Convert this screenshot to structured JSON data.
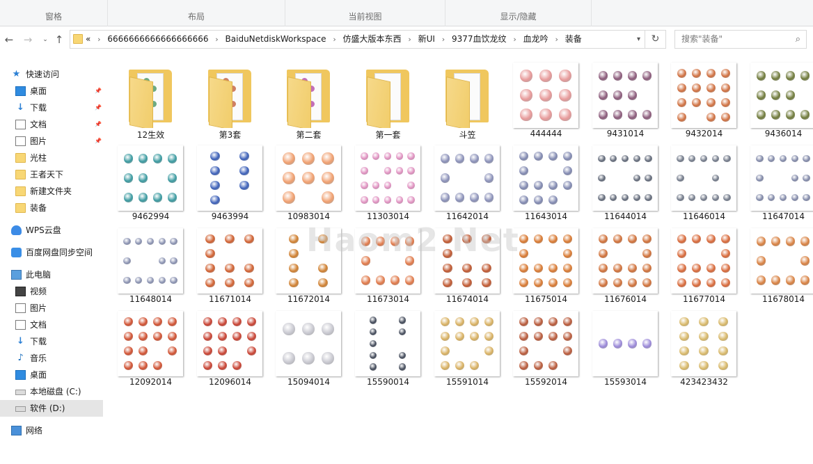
{
  "ribbon": {
    "groups": [
      "窗格",
      "布局",
      "当前视图",
      "显示/隐藏"
    ]
  },
  "addressbar": {
    "breadcrumbs": [
      "6666666666666666666",
      "BaiduNetdiskWorkspace",
      "仿盛大版本东西",
      "新UI",
      "9377血饮龙纹",
      "血龙吟",
      "装备"
    ],
    "overflow": "«",
    "search_placeholder": "搜索\"装备\""
  },
  "sidebar": {
    "items": [
      {
        "label": "快速访问",
        "icon": "star-icon"
      },
      {
        "label": "桌面",
        "icon": "desktop-icon",
        "pinned": true
      },
      {
        "label": "下载",
        "icon": "download-icon",
        "pinned": true
      },
      {
        "label": "文档",
        "icon": "document-icon",
        "pinned": true
      },
      {
        "label": "图片",
        "icon": "picture-icon",
        "pinned": true
      },
      {
        "label": "光柱",
        "icon": "folder-icon"
      },
      {
        "label": "王者天下",
        "icon": "folder-icon"
      },
      {
        "label": "新建文件夹",
        "icon": "folder-icon"
      },
      {
        "label": "装备",
        "icon": "folder-icon"
      },
      {
        "label": "WPS云盘",
        "icon": "cloud-icon"
      },
      {
        "label": "百度网盘同步空间",
        "icon": "baidu-netdisk-icon"
      },
      {
        "label": "此电脑",
        "icon": "computer-icon"
      },
      {
        "label": "视频",
        "icon": "video-icon"
      },
      {
        "label": "图片",
        "icon": "picture-icon"
      },
      {
        "label": "文档",
        "icon": "document-icon"
      },
      {
        "label": "下载",
        "icon": "download-icon"
      },
      {
        "label": "音乐",
        "icon": "music-icon"
      },
      {
        "label": "桌面",
        "icon": "desktop-icon"
      },
      {
        "label": "本地磁盘 (C:)",
        "icon": "drive-icon"
      },
      {
        "label": "软件 (D:)",
        "icon": "drive-icon",
        "selected": true
      },
      {
        "label": "网络",
        "icon": "network-icon"
      }
    ]
  },
  "files": [
    {
      "name": "12生效",
      "kind": "folder",
      "tint": "#3d8f5a"
    },
    {
      "name": "第3套",
      "kind": "folder",
      "tint": "#c0552f"
    },
    {
      "name": "第二套",
      "kind": "folder",
      "tint": "#b03fa0"
    },
    {
      "name": "第一套",
      "kind": "folder",
      "tint": ""
    },
    {
      "name": "斗笠",
      "kind": "folder",
      "tint": ""
    },
    {
      "name": "444444",
      "kind": "image",
      "tint": "#e79a9a",
      "rows": 3,
      "cols": 3
    },
    {
      "name": "9431014",
      "kind": "image",
      "tint": "#8b5a7a",
      "rows": 3,
      "cols": 4
    },
    {
      "name": "9432014",
      "kind": "image",
      "tint": "#d07040",
      "rows": 4,
      "cols": 4
    },
    {
      "name": "9436014",
      "kind": "image",
      "tint": "#6f7a3a",
      "rows": 3,
      "cols": 4
    },
    {
      "name": "9462994",
      "kind": "image",
      "tint": "#3a9aa0",
      "rows": 3,
      "cols": 4
    },
    {
      "name": "9463994",
      "kind": "image",
      "tint": "#3b5fb8",
      "rows": 4,
      "cols": 2
    },
    {
      "name": "10983014",
      "kind": "image",
      "tint": "#f0a070",
      "rows": 3,
      "cols": 3
    },
    {
      "name": "11303014",
      "kind": "image",
      "tint": "#e090c0",
      "rows": 4,
      "cols": 5
    },
    {
      "name": "11642014",
      "kind": "image",
      "tint": "#8a90b8",
      "rows": 3,
      "cols": 4
    },
    {
      "name": "11643014",
      "kind": "image",
      "tint": "#8088b0",
      "rows": 4,
      "cols": 4
    },
    {
      "name": "11644014",
      "kind": "image",
      "tint": "#606878",
      "rows": 3,
      "cols": 5
    },
    {
      "name": "11646014",
      "kind": "image",
      "tint": "#707888",
      "rows": 3,
      "cols": 5
    },
    {
      "name": "11647014",
      "kind": "image",
      "tint": "#8088a8",
      "rows": 3,
      "cols": 5
    },
    {
      "name": "11648014",
      "kind": "image",
      "tint": "#8890b0",
      "rows": 3,
      "cols": 5
    },
    {
      "name": "11671014",
      "kind": "image",
      "tint": "#d06030",
      "rows": 4,
      "cols": 3
    },
    {
      "name": "11672014",
      "kind": "image",
      "tint": "#d08030",
      "rows": 4,
      "cols": 2
    },
    {
      "name": "11673014",
      "kind": "image",
      "tint": "#e07848",
      "rows": 3,
      "cols": 4
    },
    {
      "name": "11674014",
      "kind": "image",
      "tint": "#c05830",
      "rows": 4,
      "cols": 3
    },
    {
      "name": "11675014",
      "kind": "image",
      "tint": "#d87830",
      "rows": 4,
      "cols": 4
    },
    {
      "name": "11676014",
      "kind": "image",
      "tint": "#d07038",
      "rows": 4,
      "cols": 4
    },
    {
      "name": "11677014",
      "kind": "image",
      "tint": "#d86838",
      "rows": 4,
      "cols": 4
    },
    {
      "name": "11678014",
      "kind": "image",
      "tint": "#d88040",
      "rows": 3,
      "cols": 4
    },
    {
      "name": "12092014",
      "kind": "image",
      "tint": "#d05030",
      "rows": 4,
      "cols": 4
    },
    {
      "name": "12096014",
      "kind": "image",
      "tint": "#c84030",
      "rows": 4,
      "cols": 4
    },
    {
      "name": "15094014",
      "kind": "image",
      "tint": "#c8c8d0",
      "rows": 2,
      "cols": 3
    },
    {
      "name": "15590014",
      "kind": "image",
      "tint": "#404858",
      "rows": 5,
      "cols": 2
    },
    {
      "name": "15591014",
      "kind": "image",
      "tint": "#d8b060",
      "rows": 4,
      "cols": 4
    },
    {
      "name": "15592014",
      "kind": "image",
      "tint": "#b85838",
      "rows": 4,
      "cols": 4
    },
    {
      "name": "15593014",
      "kind": "image",
      "tint": "#9a88d8",
      "rows": 1,
      "cols": 4
    },
    {
      "name": "423423432",
      "kind": "image",
      "tint": "#d8b868",
      "rows": 4,
      "cols": 3
    }
  ],
  "watermark": "Haom2 Net"
}
